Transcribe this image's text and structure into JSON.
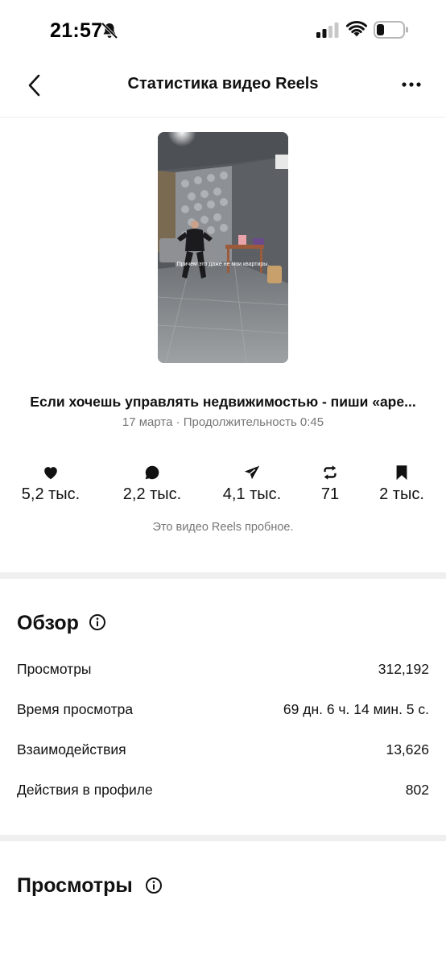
{
  "status_bar": {
    "time": "21:57"
  },
  "header": {
    "title": "Статистика видео Reels"
  },
  "video": {
    "caption": "Причем это даже не мои квартиры."
  },
  "post": {
    "title": "Если хочешь управлять недвижимостью - пиши «аре...",
    "meta": "17 марта · Продолжительность 0:45"
  },
  "stats": {
    "likes": "5,2 тыс.",
    "comments": "2,2 тыс.",
    "shares": "4,1 тыс.",
    "reposts": "71",
    "saves": "2 тыс.",
    "note": "Это видео Reels пробное."
  },
  "overview": {
    "title": "Обзор",
    "rows": [
      {
        "label": "Просмотры",
        "value": "312,192"
      },
      {
        "label": "Время просмотра",
        "value": "69 дн. 6 ч. 14 мин. 5 с."
      },
      {
        "label": "Взаимодействия",
        "value": "13,626"
      },
      {
        "label": "Действия в профиле",
        "value": "802"
      }
    ]
  },
  "views_section": {
    "title": "Просмотры"
  },
  "colors": {
    "text": "#111111",
    "muted": "#777777",
    "divider": "#efefef"
  }
}
